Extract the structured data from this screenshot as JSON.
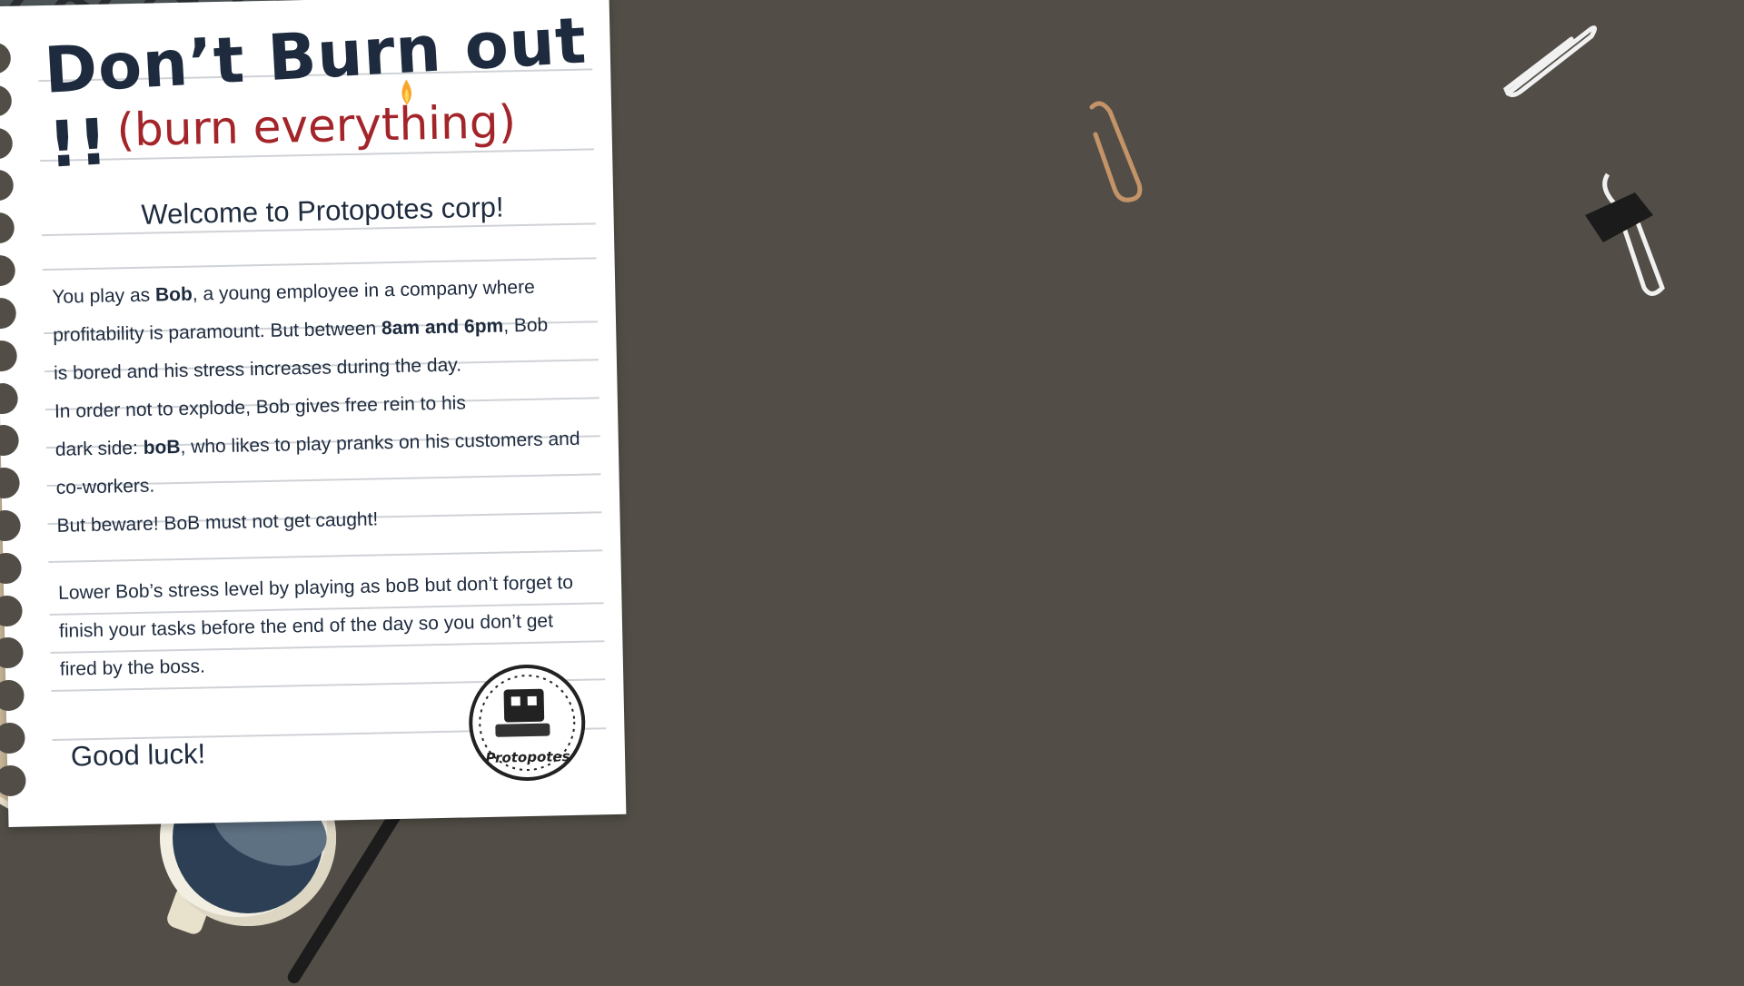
{
  "title": "Don’t Burn out !!",
  "subtitle": "(burn everything)",
  "welcome": "Welcome to Protopotes corp!",
  "intro": {
    "l1a": "You play as ",
    "l1b": "Bob",
    "l1c": ", a young employee in a company where",
    "l2a": "profitability is paramount. But between ",
    "l2b": "8am and 6pm",
    "l2c": ", Bob",
    "l3": "is bored and his stress increases during the day.",
    "l4": "In order not to explode, Bob gives free rein to his",
    "l5a": "dark side: ",
    "l5b": "boB",
    "l5c": ", who likes to play pranks on his customers and",
    "l6": "co-workers.",
    "l7": "But beware! BoB must not get caught!"
  },
  "goal": {
    "l1": "Lower Bob’s stress level by playing as boB but don’t forget to",
    "l2": "finish your tasks before the end of the day so you don’t get",
    "l3": "fired by the boss."
  },
  "closing": "Good luck!",
  "logo": {
    "text": "Protopotes",
    "icon": "protopotes-logo-icon"
  },
  "colors": {
    "desk": "#524e47",
    "title": "#1e2b3e",
    "subtitle": "#a3252a",
    "paper": "#ffffff"
  }
}
